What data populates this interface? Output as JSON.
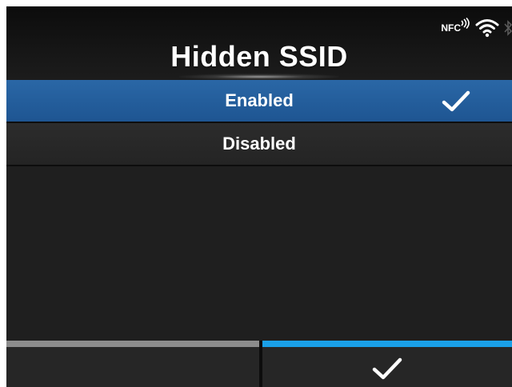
{
  "header": {
    "title": "Hidden SSID",
    "status": {
      "nfc_label": "NFC",
      "icons": [
        "nfc-icon",
        "wifi-icon",
        "bluetooth-icon"
      ]
    }
  },
  "options": [
    {
      "label": "Enabled",
      "selected": true
    },
    {
      "label": "Disabled",
      "selected": false
    }
  ],
  "footer": {
    "left_button_icon": "",
    "right_button_icon": "check-icon"
  },
  "colors": {
    "selected_row": "#1e5592",
    "confirm_bar": "#1aa0e8",
    "back_bar": "#8c8c8c",
    "background": "#1f1f1f"
  }
}
